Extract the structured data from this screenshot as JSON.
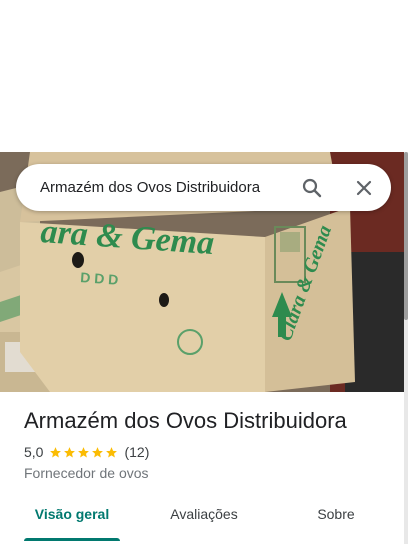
{
  "search": {
    "query": "Armazém dos Ovos Distribuidora",
    "search_icon": "search-icon",
    "close_icon": "close-icon"
  },
  "hero": {
    "description_icon": "photo",
    "box_brand": "Clara & Gema"
  },
  "place": {
    "name": "Armazém dos Ovos Distribuidora",
    "rating": "5,0",
    "stars": 5,
    "review_count": "(12)",
    "category": "Fornecedor de ovos"
  },
  "tabs": [
    {
      "label": "Visão geral",
      "active": true
    },
    {
      "label": "Avaliações",
      "active": false
    },
    {
      "label": "Sobre",
      "active": false
    }
  ],
  "colors": {
    "accent": "#01796f",
    "star": "#fbbc04",
    "box_green": "#2e8b4e"
  }
}
